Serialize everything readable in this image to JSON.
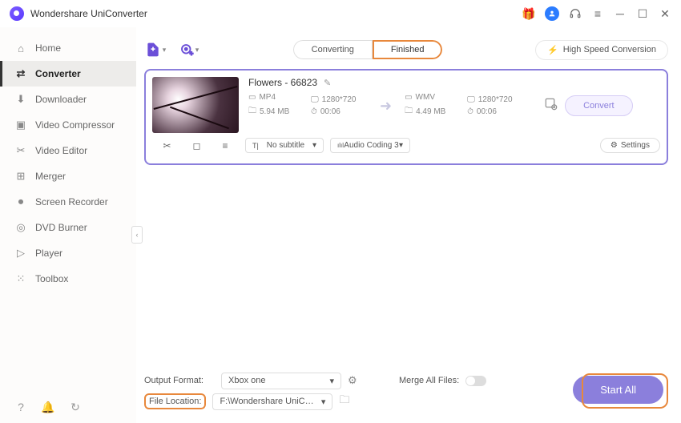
{
  "app": {
    "title": "Wondershare UniConverter"
  },
  "sidebar": {
    "items": [
      {
        "label": "Home"
      },
      {
        "label": "Converter"
      },
      {
        "label": "Downloader"
      },
      {
        "label": "Video Compressor"
      },
      {
        "label": "Video Editor"
      },
      {
        "label": "Merger"
      },
      {
        "label": "Screen Recorder"
      },
      {
        "label": "DVD Burner"
      },
      {
        "label": "Player"
      },
      {
        "label": "Toolbox"
      }
    ]
  },
  "tabs": {
    "converting": "Converting",
    "finished": "Finished"
  },
  "hspeed": {
    "label": "High Speed Conversion"
  },
  "file": {
    "name": "Flowers - 66823",
    "src": {
      "format": "MP4",
      "res": "1280*720",
      "size": "5.94 MB",
      "dur": "00:06"
    },
    "dst": {
      "format": "WMV",
      "res": "1280*720",
      "size": "4.49 MB",
      "dur": "00:06"
    },
    "convert_label": "Convert",
    "subtitle": "No subtitle",
    "audio": "Audio Coding 3",
    "settings_label": "Settings"
  },
  "footer": {
    "outfmt_label": "Output Format:",
    "outfmt_value": "Xbox one",
    "loc_label": "File Location:",
    "loc_value": "F:\\Wondershare UniConverter",
    "merge_label": "Merge All Files:",
    "start_label": "Start All"
  }
}
